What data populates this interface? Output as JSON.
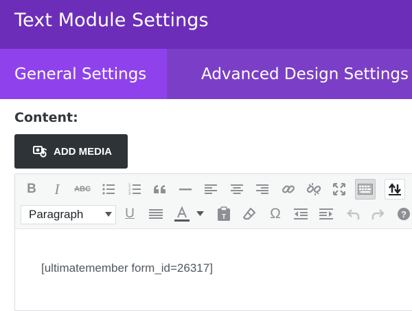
{
  "header": {
    "title": "Text Module Settings"
  },
  "tabs": [
    {
      "label": "General Settings",
      "active": true
    },
    {
      "label": "Advanced Design Settings",
      "active": false
    }
  ],
  "content": {
    "label": "Content:",
    "add_media_label": "ADD MEDIA"
  },
  "toolbar": {
    "format_select_value": "Paragraph",
    "row1": [
      "bold-icon",
      "italic-icon",
      "strikethrough-icon",
      "bullet-list-icon",
      "numbered-list-icon",
      "blockquote-icon",
      "horizontal-line-icon",
      "align-left-icon",
      "align-center-icon",
      "align-right-icon",
      "link-icon",
      "unlink-icon",
      "fullscreen-icon",
      "toolbar-toggle-icon",
      "upload-icon"
    ],
    "row2": [
      "underline-icon",
      "justify-icon",
      "text-color-icon",
      "paste-text-icon",
      "clear-formatting-icon",
      "special-character-icon",
      "outdent-icon",
      "indent-icon",
      "undo-icon",
      "redo-icon",
      "help-icon"
    ]
  },
  "editor": {
    "body_text": "[ultimatemember form_id=26317]"
  },
  "colors": {
    "header": "#6c2eb9",
    "tab_bar": "#7b3fc7",
    "active_tab": "#8f42ec",
    "button_dark": "#2e3338"
  }
}
